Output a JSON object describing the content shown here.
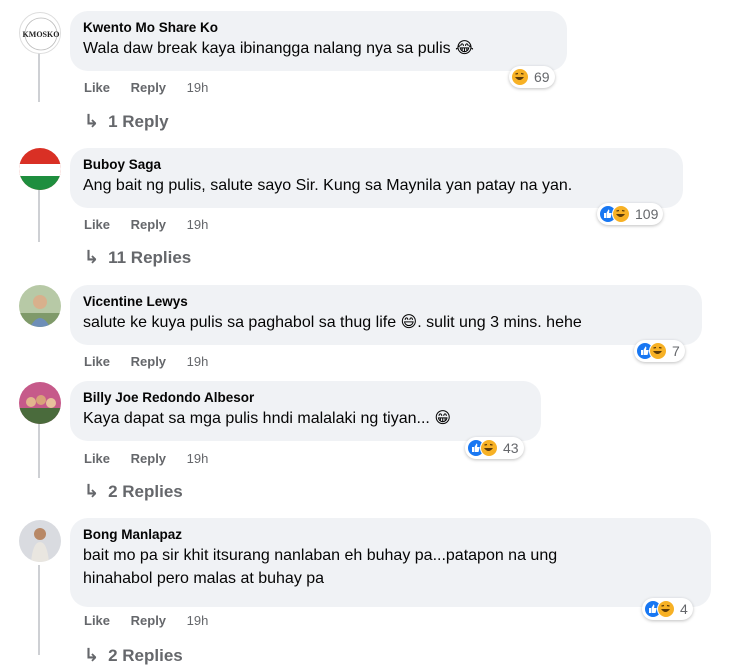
{
  "comments": [
    {
      "author": "Kwento Mo Share Ko",
      "text": "Wala daw break kaya ibinangga nalang nya sa pulis 😂",
      "like": "Like",
      "reply": "Reply",
      "time": "19h",
      "reaction_count": "69",
      "reactions": [
        "haha"
      ],
      "replies": "1 Reply",
      "avatar_text": "KMOSKO"
    },
    {
      "author": "Buboy Saga",
      "text": "Ang bait ng pulis, salute sayo Sir. Kung sa Maynila yan patay na yan.",
      "like": "Like",
      "reply": "Reply",
      "time": "19h",
      "reaction_count": "109",
      "reactions": [
        "like",
        "haha"
      ],
      "replies": "11 Replies"
    },
    {
      "author": "Vicentine Lewys",
      "text": "salute ke kuya pulis sa paghabol sa thug life 😄. sulit ung 3 mins. hehe",
      "like": "Like",
      "reply": "Reply",
      "time": "19h",
      "reaction_count": "7",
      "reactions": [
        "like",
        "haha"
      ]
    },
    {
      "author": "Billy Joe Redondo Albesor",
      "text": "Kaya dapat sa mga pulis hndi malalaki ng tiyan... 😁",
      "like": "Like",
      "reply": "Reply",
      "time": "19h",
      "reaction_count": "43",
      "reactions": [
        "like",
        "haha"
      ],
      "replies": "2 Replies"
    },
    {
      "author": "Bong Manlapaz",
      "text_line1": "bait mo pa sir khit itsurang nanlaban eh buhay pa...patapon na ung",
      "text_line2": "hinahabol pero malas at buhay pa",
      "like": "Like",
      "reply": "Reply",
      "time": "19h",
      "reaction_count": "4",
      "reactions": [
        "like",
        "haha"
      ],
      "replies": "2 Replies"
    }
  ],
  "icons": {
    "reply_arrow": "reply-arrow-icon",
    "like": "like-reaction-icon",
    "haha": "haha-reaction-icon"
  },
  "colors": {
    "bubble": "#f0f2f5",
    "meta": "#65676b",
    "like_blue": "#1877f2",
    "haha_yellow": "#f7b125"
  }
}
